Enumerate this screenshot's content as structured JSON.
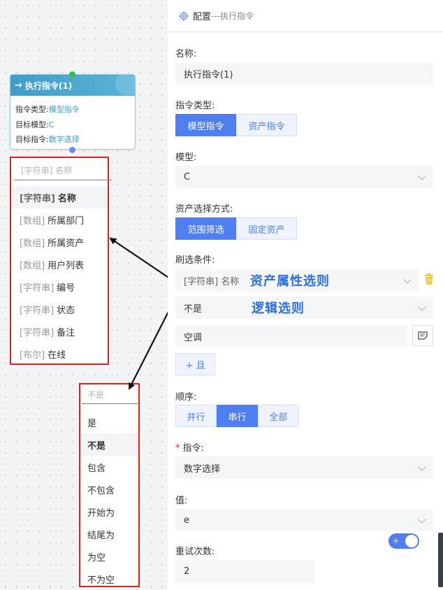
{
  "node": {
    "title": "执行指令(1)",
    "arrow_icon": "→",
    "lines": [
      {
        "label": "指令类型:",
        "value": "模型指令"
      },
      {
        "label": "目标模型:",
        "value": "C"
      },
      {
        "label": "目标指令:",
        "value": "数字选择"
      }
    ],
    "colors": {
      "header": "#3f9dc8",
      "top_port": "#2fbf4a",
      "bottom_port": "#5b8ef0"
    }
  },
  "attr_dropdown": {
    "placeholder": "[字符串] 名称",
    "items": [
      {
        "type": "[字符串]",
        "name": "名称",
        "active": true
      },
      {
        "type": "[数组]",
        "name": "所属部门",
        "active": false
      },
      {
        "type": "[数组]",
        "name": "所属资产",
        "active": false
      },
      {
        "type": "[数组]",
        "name": "用户列表",
        "active": false
      },
      {
        "type": "[字符串]",
        "name": "编号",
        "active": false
      },
      {
        "type": "[字符串]",
        "name": "状态",
        "active": false
      },
      {
        "type": "[字符串]",
        "name": "备注",
        "active": false
      },
      {
        "type": "[布尔]",
        "name": "在线",
        "active": false
      }
    ]
  },
  "logic_dropdown": {
    "placeholder": "不是",
    "items": [
      {
        "name": "是",
        "active": false
      },
      {
        "name": "不是",
        "active": true
      },
      {
        "name": "包含",
        "active": false
      },
      {
        "name": "不包含",
        "active": false
      },
      {
        "name": "开始为",
        "active": false
      },
      {
        "name": "结尾为",
        "active": false
      },
      {
        "name": "为空",
        "active": false
      },
      {
        "name": "不为空",
        "active": false
      }
    ]
  },
  "panel": {
    "title": "配置",
    "subtitle": "---执行指令",
    "name_label": "名称:",
    "name_value": "执行指令(1)",
    "cmd_type_label": "指令类型:",
    "cmd_type_options": [
      "模型指令",
      "资产指令"
    ],
    "cmd_type_selected": 0,
    "model_label": "模型:",
    "model_value": "C",
    "asset_mode_label": "资产选择方式:",
    "asset_mode_options": [
      "范围筛选",
      "固定资产"
    ],
    "asset_mode_selected": 0,
    "filter_label": "刷选条件:",
    "filter_attr_value": "[字符串] 名称",
    "filter_logic_value": "不是",
    "filter_input_value": "空调",
    "add_button": "+ 且",
    "order_label": "顺序:",
    "order_options": [
      "并行",
      "串行",
      "全部"
    ],
    "order_selected": 1,
    "command_label": "指令:",
    "command_required": "*",
    "command_value": "数字选择",
    "value_label": "值:",
    "value_value": "e",
    "retry_label": "重试次数:",
    "retry_value": "2"
  },
  "annotations": {
    "attr": "资产属性选则",
    "logic": "逻辑选则"
  },
  "colors": {
    "primary": "#4e7ef0",
    "highlight_box": "#e02020",
    "annotation_text": "#2f6fd8",
    "trash": "#f0c040"
  }
}
